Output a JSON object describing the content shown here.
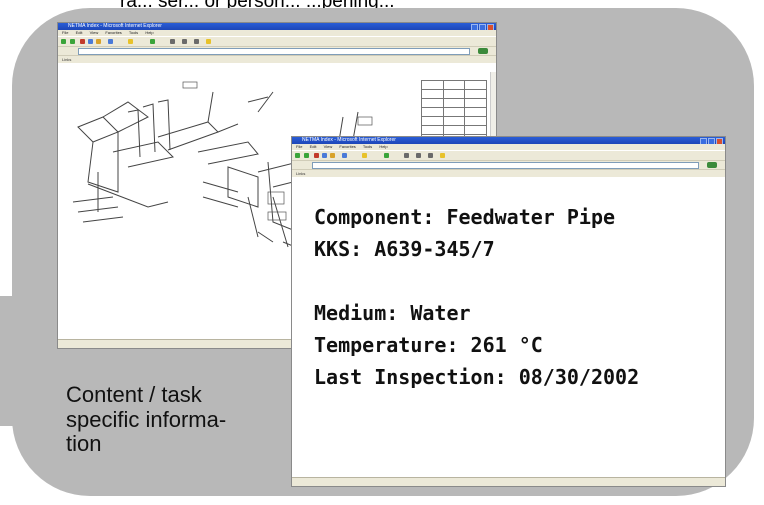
{
  "top_caption": "ra... ser... or person... ...pening...",
  "window_back": {
    "title": "NETMA Index - Microsoft Internet Explorer",
    "menu": [
      "File",
      "Edit",
      "View",
      "Favorites",
      "Tools",
      "Help"
    ],
    "address": "http://servers.tcweb.de/...",
    "links": [
      "Links",
      "Google",
      "Click for Microsoft",
      "MSN",
      "Customize Links",
      "Netmeeting",
      "ARD",
      "Hotmail",
      "Windows",
      "Software 1.3 Grade",
      "NOVACOM Bookmark & Info"
    ]
  },
  "window_front": {
    "title": "NETMA Index - Microsoft Internet Explorer",
    "menu": [
      "File",
      "Edit",
      "View",
      "Favorites",
      "Tools",
      "Help"
    ],
    "address": "http://servers.tcweb.de/...",
    "links": [
      "Links",
      "Google",
      "Click for Microsoft",
      "MSN",
      "Customize Links",
      "Netmeeting",
      "ARD",
      "Hotmail",
      "Windows",
      "Software 1.3 Grade",
      "NOVACOM Bookmark & Info"
    ],
    "status": "Internet"
  },
  "info": {
    "component": "Component: Feedwater Pipe",
    "kks": "KKS: A639-345/7",
    "medium": "Medium: Water",
    "temperature": "Temperature: 261 °C",
    "last_inspection": "Last Inspection: 08/30/2002"
  },
  "caption": {
    "line1": "Content / task",
    "line2": "specific informa-",
    "line3": "tion"
  }
}
